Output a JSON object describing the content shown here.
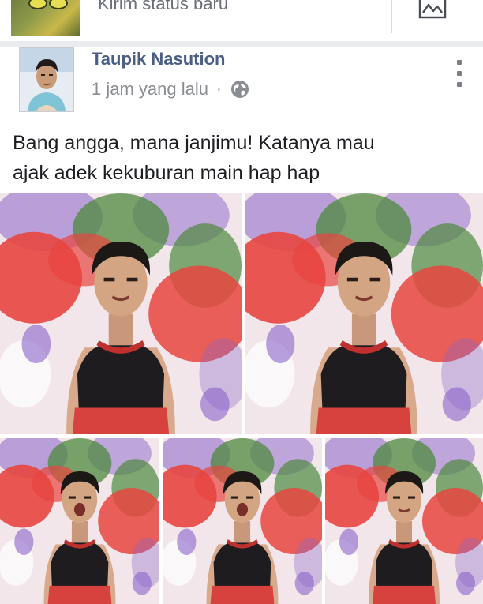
{
  "composer": {
    "placeholder": "Kirim status baru",
    "photo_icon": "photo-icon"
  },
  "post": {
    "author": "Taupik Nasution",
    "time": "1 jam yang lalu",
    "separator": "·",
    "privacy_icon": "globe-icon",
    "more_icon": "more-options-icon",
    "text_line1": "Bang angga, mana janjimu! Katanya mau",
    "text_line2": "ajak adek kekuburan main hap hap",
    "photos": [
      "photo-1",
      "photo-2",
      "photo-3",
      "photo-4",
      "photo-5"
    ]
  },
  "colors": {
    "author": "#4b5f86",
    "meta": "#8a8d91",
    "text": "#1c1e21",
    "backdrop_red": "#e8453f",
    "backdrop_green": "#4d8a3e",
    "backdrop_purple": "#8a63c9"
  }
}
